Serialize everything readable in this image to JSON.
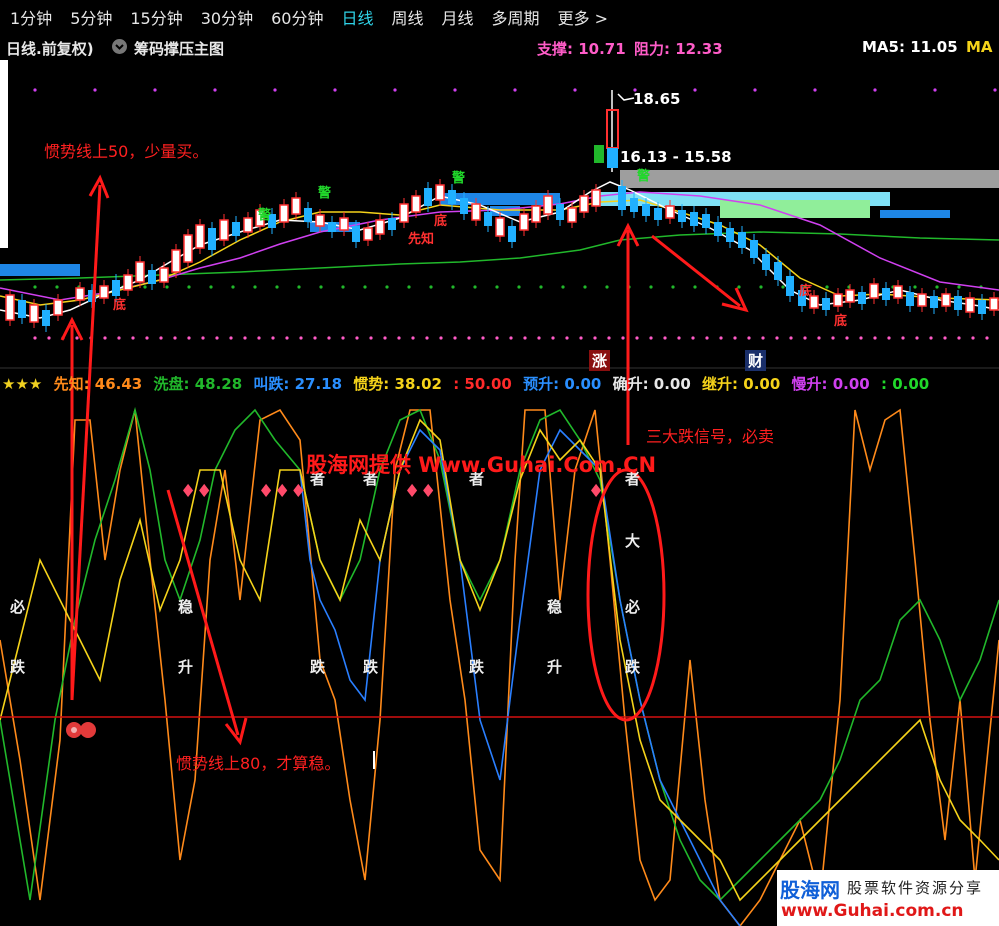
{
  "period_tabs": [
    "1分钟",
    "5分钟",
    "15分钟",
    "30分钟",
    "60分钟",
    "日线",
    "周线",
    "月线",
    "多周期",
    "更多 >"
  ],
  "active_period": "日线",
  "chart_header": {
    "period_label": "日线.前复权)",
    "dropdown_icon": "chevron-down-icon",
    "indicator_name": "筹码撑压主图",
    "support_label": "支撑: 10.71",
    "resistance_label": "阻力: 12.33",
    "ma5_label": "MA5: 11.05",
    "ma_more": "MA"
  },
  "price_marks": {
    "high": "18.65",
    "range": "16.13 - 15.58"
  },
  "candle_tags": {
    "jing": "警",
    "di": "底",
    "xianzhi": "先知"
  },
  "event_tags": {
    "zhang": "涨",
    "cai": "财"
  },
  "indicator_bar": {
    "stars": "★★★",
    "xianzhi": "先知: 46.43",
    "xipan": "洗盘: 48.28",
    "jiaodie": "叫跌: 27.18",
    "guanshi": "惯势: 38.02",
    "fifty": ": 50.00",
    "yusheng": "预升: 0.00",
    "quesheng": "确升: 0.00",
    "jisheng": "继升: 0.00",
    "mansheng": "慢升: 0.00",
    "last": ": 0.00"
  },
  "signal_texts": {
    "bi": "必",
    "die": "跌",
    "wen": "稳",
    "sheng": "升",
    "zhe": "者",
    "da": "大"
  },
  "annotations": {
    "top": "惯势线上50，少量买。",
    "bottom": "惯势线上80，才算稳。",
    "right": "三大跌信号，必卖"
  },
  "watermark": "股海网提供 Www.Guhai.Com.CN",
  "badge": {
    "name": "股海网",
    "slogan": "股票软件资源分享",
    "url": "www.Guhai.com.cn"
  },
  "colors": {
    "accent_tab": "#2fd3e8",
    "up": "#ff3030",
    "down": "#20b0ff",
    "support": "#ff66cc",
    "resistance": "#ff66cc",
    "ma5": "#ffffff",
    "yellow": "#f5d31a",
    "green": "#21b82b",
    "orange": "#ff8a1a",
    "blue": "#2a7fff",
    "magenta": "#d040f0"
  }
}
